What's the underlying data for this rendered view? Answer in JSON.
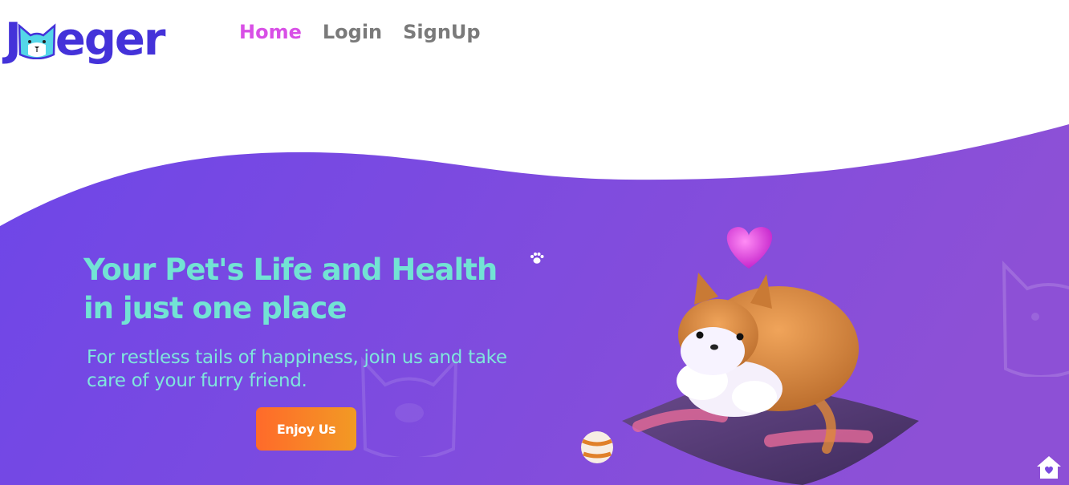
{
  "brand": {
    "logo_text_start": "J",
    "logo_text_end": "eger",
    "logo_icon": "cat-face-icon",
    "color": "#4432d9"
  },
  "nav": {
    "items": [
      {
        "label": "Home",
        "active": true
      },
      {
        "label": "Login",
        "active": false
      },
      {
        "label": "SignUp",
        "active": false
      }
    ]
  },
  "hero": {
    "title": "Your Pet's Life and Health in just one place",
    "subtitle": "For restless tails of happiness, join us and take care of your furry friend.",
    "cta_label": "Enjoy Us",
    "title_icon": "paw-icon"
  },
  "floating_action": {
    "icon": "home-heart-icon"
  },
  "colors": {
    "accent": "#d84fe6",
    "hero_start": "#6f46e6",
    "hero_end": "#8a4fd8",
    "title": "#72e3d4",
    "cta_start": "#ff6a2a",
    "cta_end": "#f29a24"
  }
}
